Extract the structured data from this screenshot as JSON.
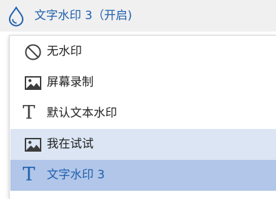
{
  "watermark_dropdown": {
    "current_label": "文字水印 3（开启)",
    "icon": "water-drop-icon"
  },
  "menu": {
    "items": [
      {
        "label": "无水印",
        "icon": "no-watermark-icon",
        "state": "normal"
      },
      {
        "label": "屏幕录制",
        "icon": "image-icon",
        "state": "normal"
      },
      {
        "label": "默认文本水印",
        "icon": "text-t-icon",
        "state": "normal"
      },
      {
        "label": "我在试试",
        "icon": "image-icon",
        "state": "hovered"
      },
      {
        "label": "文字水印 3",
        "icon": "text-t-icon",
        "state": "selected"
      }
    ]
  },
  "colors": {
    "accent": "#1f5fae",
    "hover_bg": "#dbe5f3",
    "selected_bg": "#b1c6e8",
    "topbar_bg": "#f0f0f0"
  }
}
